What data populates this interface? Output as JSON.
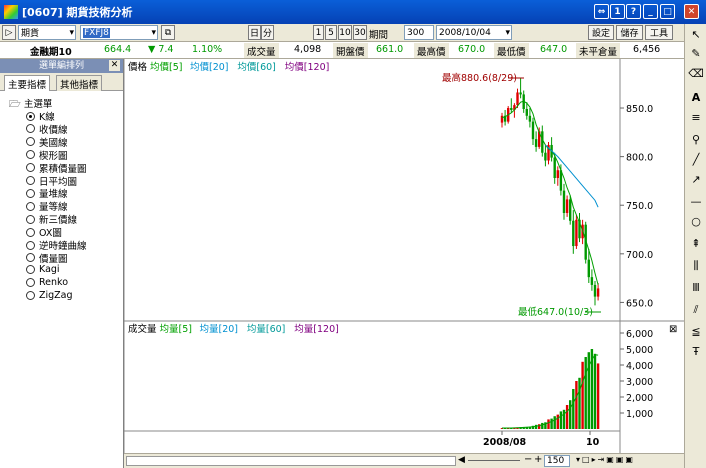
{
  "window": {
    "title": "[0607] 期貨技術分析",
    "title_buttons": [
      "⇔",
      "1",
      "?",
      "_",
      "□",
      "✕"
    ]
  },
  "toolbar": {
    "market": "期貨",
    "symbol": "FXFJ8",
    "period_day": "日",
    "period_min": "分",
    "intervals": [
      "1",
      "5",
      "10",
      "30"
    ],
    "period_label": "期間",
    "period_value": "300",
    "date_value": "2008/10/04",
    "settings": "設定",
    "save": "儲存",
    "tools": "工具"
  },
  "quote": {
    "name": "金融期10",
    "price": "664.4",
    "change": "▼ 7.4",
    "pct": "1.10%",
    "volume_label": "成交量",
    "volume": "4,098",
    "open_label": "開盤價",
    "open": "661.0",
    "high_label": "最高價",
    "high": "670.0",
    "low_label": "最低價",
    "low": "647.0",
    "oi_label": "未平倉量",
    "oi": "6,456"
  },
  "left_panel": {
    "header": "選單編排列",
    "tabs": [
      "主要指標",
      "其他指標"
    ],
    "root": "主選單",
    "items": [
      "K線",
      "收價線",
      "美國線",
      "楔形圖",
      "累積價量圖",
      "日平均圖",
      "量堆線",
      "量等線",
      "新三價線",
      "OX圖",
      "逆時鐘曲線",
      "價量圖",
      "Kagi",
      "Renko",
      "ZigZag"
    ],
    "selected_index": 0
  },
  "price_pane": {
    "legend": {
      "main": "價格",
      "ma5": "均價[5]",
      "ma20": "均價[20]",
      "ma60": "均價[60]",
      "ma120": "均價[120]"
    },
    "high_annotation": "最高880.6(8/29)",
    "low_annotation": "最低647.0(10/3)",
    "yticks": [
      "850.0",
      "800.0",
      "750.0",
      "700.0",
      "650.0"
    ],
    "colors": {
      "up": "#e00000",
      "down": "#009900",
      "ma5": "#00a000",
      "ma20": "#0090d0",
      "ma60": "#009999",
      "ma120": "#800080"
    }
  },
  "volume_pane": {
    "legend": {
      "main": "成交量",
      "ma5": "均量[5]",
      "ma20": "均量[20]",
      "ma60": "均量[60]",
      "ma120": "均量[120]"
    },
    "yticks": [
      "6,000",
      "5,000",
      "4,000",
      "3,000",
      "2,000",
      "1,000"
    ],
    "xlabels": [
      "2008/08",
      "10"
    ]
  },
  "bottom_bar": {
    "zoom": "150"
  },
  "chart_data": {
    "type": "candlestick",
    "price_range": [
      635,
      885
    ],
    "volume_range": [
      0,
      6500
    ],
    "candles": [
      {
        "o": 835,
        "h": 845,
        "l": 830,
        "c": 842
      },
      {
        "o": 842,
        "h": 848,
        "l": 832,
        "c": 836
      },
      {
        "o": 836,
        "h": 852,
        "l": 834,
        "c": 850
      },
      {
        "o": 850,
        "h": 860,
        "l": 845,
        "c": 848
      },
      {
        "o": 848,
        "h": 855,
        "l": 840,
        "c": 853
      },
      {
        "o": 853,
        "h": 870,
        "l": 850,
        "c": 866
      },
      {
        "o": 866,
        "h": 880.6,
        "l": 860,
        "c": 864
      },
      {
        "o": 864,
        "h": 868,
        "l": 845,
        "c": 849
      },
      {
        "o": 849,
        "h": 856,
        "l": 838,
        "c": 842
      },
      {
        "o": 842,
        "h": 850,
        "l": 830,
        "c": 836
      },
      {
        "o": 836,
        "h": 840,
        "l": 812,
        "c": 818
      },
      {
        "o": 818,
        "h": 826,
        "l": 805,
        "c": 810
      },
      {
        "o": 810,
        "h": 830,
        "l": 808,
        "c": 826
      },
      {
        "o": 826,
        "h": 832,
        "l": 800,
        "c": 804
      },
      {
        "o": 804,
        "h": 812,
        "l": 790,
        "c": 796
      },
      {
        "o": 796,
        "h": 815,
        "l": 792,
        "c": 812
      },
      {
        "o": 812,
        "h": 820,
        "l": 795,
        "c": 799
      },
      {
        "o": 799,
        "h": 804,
        "l": 772,
        "c": 778
      },
      {
        "o": 778,
        "h": 790,
        "l": 770,
        "c": 786
      },
      {
        "o": 786,
        "h": 792,
        "l": 760,
        "c": 765
      },
      {
        "o": 765,
        "h": 772,
        "l": 735,
        "c": 742
      },
      {
        "o": 742,
        "h": 760,
        "l": 738,
        "c": 756
      },
      {
        "o": 756,
        "h": 760,
        "l": 730,
        "c": 734
      },
      {
        "o": 734,
        "h": 745,
        "l": 700,
        "c": 708
      },
      {
        "o": 708,
        "h": 740,
        "l": 705,
        "c": 735
      },
      {
        "o": 735,
        "h": 742,
        "l": 712,
        "c": 716
      },
      {
        "o": 716,
        "h": 735,
        "l": 710,
        "c": 730
      },
      {
        "o": 730,
        "h": 733,
        "l": 690,
        "c": 694
      },
      {
        "o": 694,
        "h": 705,
        "l": 670,
        "c": 676
      },
      {
        "o": 676,
        "h": 684,
        "l": 662,
        "c": 668
      },
      {
        "o": 668,
        "h": 672,
        "l": 647,
        "c": 656
      },
      {
        "o": 656,
        "h": 670,
        "l": 652,
        "c": 664.4
      }
    ],
    "volumes": [
      60,
      70,
      55,
      80,
      90,
      100,
      120,
      110,
      130,
      150,
      200,
      260,
      300,
      380,
      420,
      600,
      650,
      800,
      900,
      1100,
      1200,
      1500,
      1800,
      2500,
      3000,
      3200,
      4200,
      4500,
      4800,
      5000,
      4700,
      4098
    ],
    "ma5": [
      840,
      841,
      843,
      845,
      848,
      852,
      856,
      857,
      855,
      851,
      844,
      833,
      825,
      818,
      812,
      808,
      806,
      801,
      794,
      786,
      778,
      768,
      760,
      748,
      740,
      732,
      724,
      714,
      704,
      693,
      680,
      668
    ]
  }
}
